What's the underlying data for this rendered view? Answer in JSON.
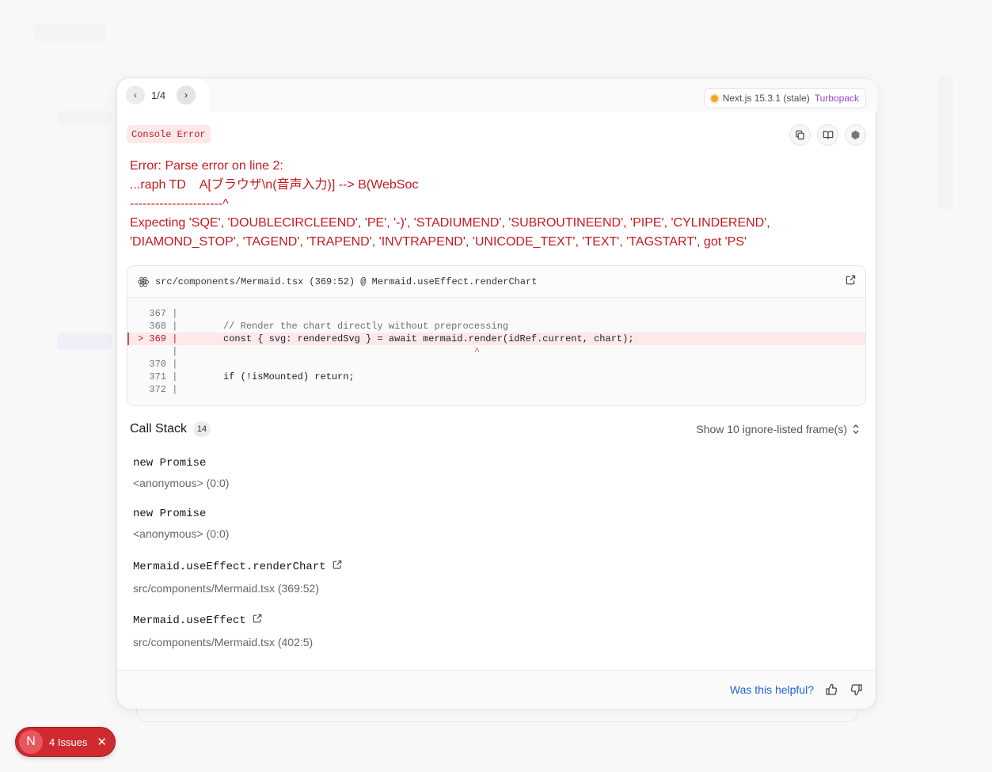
{
  "nav": {
    "counter": "1/4",
    "prev_icon": "‹",
    "next_icon": "›"
  },
  "version": {
    "label": "Next.js 15.3.1 (stale)",
    "bundler": "Turbopack",
    "status_color": "#f5a623"
  },
  "error": {
    "badge": "Console Error",
    "lines": [
      "Error: Parse error on line 2:",
      "...raph TD    A[ブラウザ\\n(音声入力)] --> B(WebSoc",
      "----------------------^",
      "Expecting 'SQE', 'DOUBLECIRCLEEND', 'PE', '-)', 'STADIUMEND', 'SUBROUTINEEND', 'PIPE', 'CYLINDEREND', 'DIAMOND_STOP', 'TAGEND', 'TRAPEND', 'INVTRAPEND', 'UNICODE_TEXT', 'TEXT', 'TAGSTART', got 'PS'"
    ]
  },
  "code_frame": {
    "file": "src/components/Mermaid.tsx (369:52) @ Mermaid.useEffect.renderChart",
    "lines": [
      {
        "gutter": "  367 |",
        "code": ""
      },
      {
        "gutter": "  368 |",
        "code": "        // Render the chart directly without preprocessing"
      },
      {
        "gutter": "> 369 |",
        "code": "        const { svg: renderedSvg } = await mermaid.render(idRef.current, chart);"
      },
      {
        "gutter": "      |",
        "code": "                                                    ^"
      },
      {
        "gutter": "  370 |",
        "code": ""
      },
      {
        "gutter": "  371 |",
        "code": "        if (!isMounted) return;"
      },
      {
        "gutter": "  372 |",
        "code": ""
      }
    ]
  },
  "call_stack": {
    "title": "Call Stack",
    "count": "14",
    "ignore_toggle": "Show 10 ignore-listed frame(s)",
    "frames": [
      {
        "name": "new Promise",
        "location": "<anonymous> (0:0)"
      },
      {
        "name": "new Promise",
        "location": "<anonymous> (0:0)"
      },
      {
        "name": "Mermaid.useEffect.renderChart",
        "location": "src/components/Mermaid.tsx (369:52)"
      },
      {
        "name": "Mermaid.useEffect",
        "location": "src/components/Mermaid.tsx (402:5)"
      }
    ]
  },
  "footer": {
    "helpful": "Was this helpful?"
  },
  "issues": {
    "logo": "N",
    "label": "4 Issues",
    "close": "✕",
    "color": "#cf2a30"
  }
}
